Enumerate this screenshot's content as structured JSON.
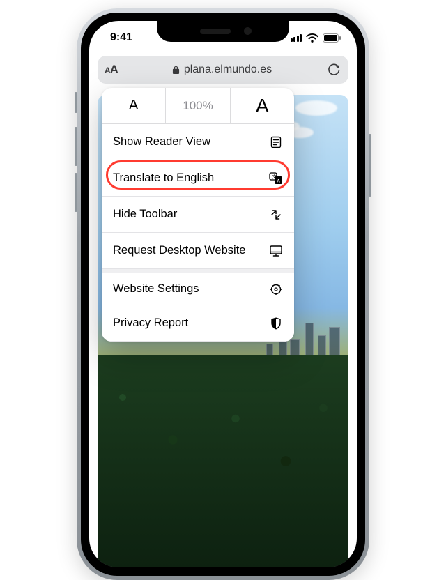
{
  "status": {
    "time": "9:41"
  },
  "urlbar": {
    "domain": "plana.elmundo.es"
  },
  "popover": {
    "zoom_label": "100%",
    "items": {
      "reader": {
        "label": "Show Reader View"
      },
      "translate": {
        "label": "Translate to English"
      },
      "hide": {
        "label": "Hide Toolbar"
      },
      "desktop": {
        "label": "Request Desktop Website"
      },
      "settings": {
        "label": "Website Settings"
      },
      "privacy": {
        "label": "Privacy Report"
      }
    }
  }
}
